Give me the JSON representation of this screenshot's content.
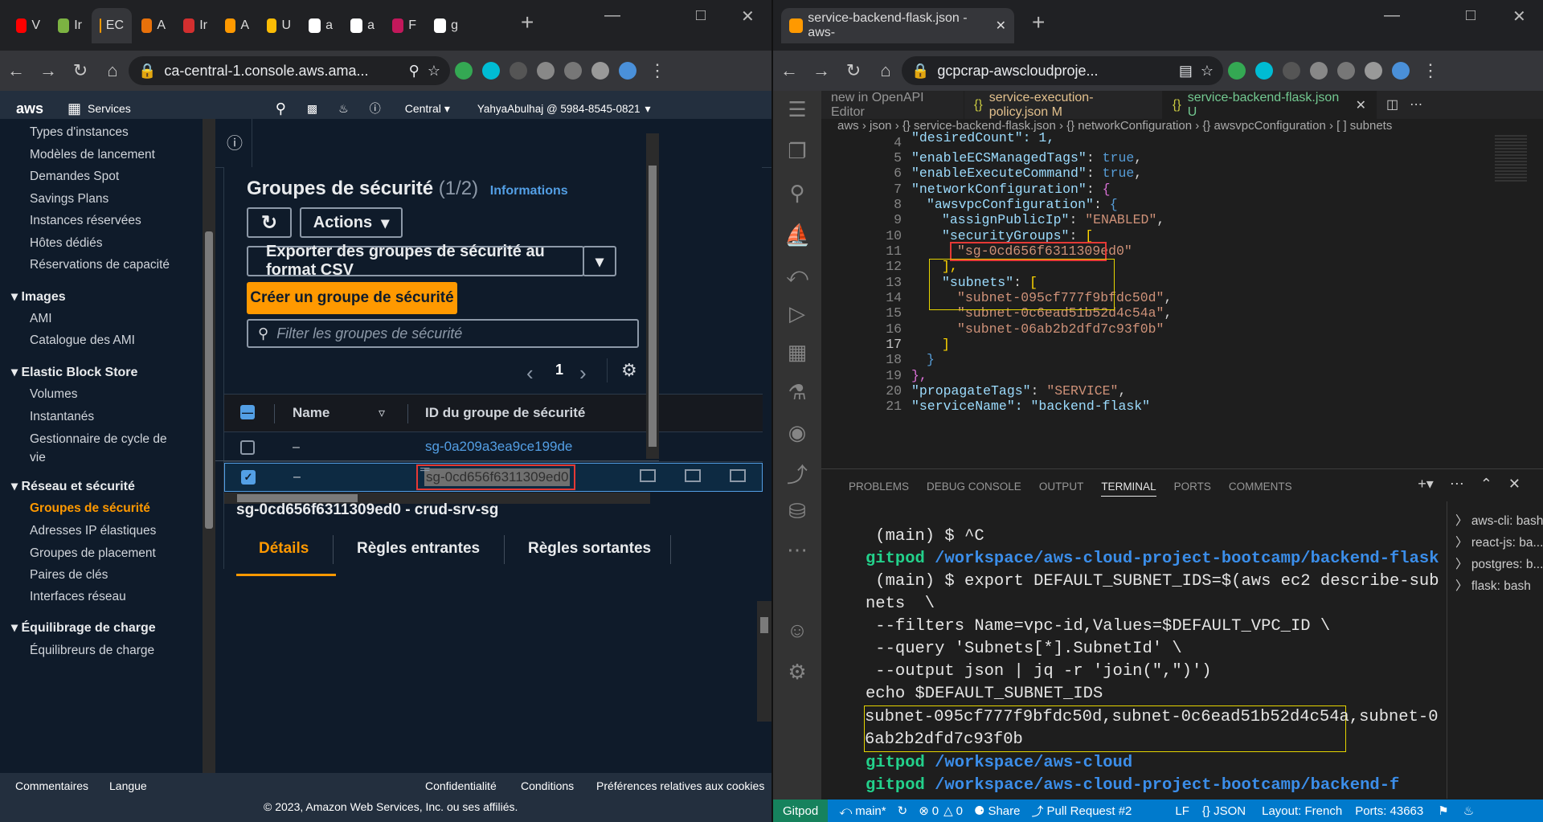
{
  "left_browser": {
    "tabs": [
      {
        "label": "V",
        "color": "#ff0000"
      },
      {
        "label": "Ir",
        "color": "#7cb342"
      },
      {
        "label": "EC",
        "color": "#ff9900"
      },
      {
        "label": "A",
        "color": "#e8710a"
      },
      {
        "label": "Ir",
        "color": "#d32f2f"
      },
      {
        "label": "A",
        "color": "#ff9900"
      },
      {
        "label": "U",
        "color": "#fbbc05"
      },
      {
        "label": "a",
        "color": "#ffffff"
      },
      {
        "label": "a",
        "color": "#ffffff"
      },
      {
        "label": "F",
        "color": "#c2185b"
      },
      {
        "label": "g",
        "color": "#ffffff"
      }
    ],
    "url": "ca-central-1.console.aws.ama..."
  },
  "aws": {
    "services": "Services",
    "region": "Central",
    "account": "YahyaAbulhaj @ 5984-8545-0821",
    "sidebar": [
      "Types d'instances",
      "Modèles de lancement",
      "Demandes Spot",
      "Savings Plans",
      "Instances réservées",
      "Hôtes dédiés",
      "Réservations de capacité"
    ],
    "sec_images": "Images",
    "images": [
      "AMI",
      "Catalogue des AMI"
    ],
    "sec_ebs": "Elastic Block Store",
    "ebs": [
      "Volumes",
      "Instantanés",
      "Gestionnaire de cycle de",
      "vie"
    ],
    "sec_net": "Réseau et sécurité",
    "net": [
      "Groupes de sécurité",
      "Adresses IP élastiques",
      "Groupes de placement",
      "Paires de clés",
      "Interfaces réseau"
    ],
    "sec_lb": "Équilibrage de charge",
    "lb": [
      "Équilibreurs de charge"
    ],
    "title": "Groupes de sécurité",
    "count": "(1/2)",
    "info": "Informations",
    "actions": "Actions",
    "export": "Exporter des groupes de sécurité au format CSV",
    "create": "Créer un groupe de sécurité",
    "filter_placeholder": "Filter les groupes de sécurité",
    "page": "1",
    "col_name": "Name",
    "col_id": "ID du groupe de sécurité",
    "rows": [
      {
        "name": "–",
        "id": "sg-0a209a3ea9ce199de"
      },
      {
        "name": "–",
        "id": "sg-0cd656f6311309ed0"
      }
    ],
    "detail_title": "sg-0cd656f6311309ed0 - crud-srv-sg",
    "dtabs": [
      "Détails",
      "Règles entrantes",
      "Règles sortantes"
    ],
    "footer": {
      "feedback": "Commentaires",
      "lang": "Langue",
      "privacy": "Confidentialité",
      "conditions": "Conditions",
      "cookies": "Préférences relatives aux cookies",
      "copyright": "© 2023, Amazon Web Services, Inc. ou ses affiliés."
    }
  },
  "right_browser": {
    "tab": "service-backend-flask.json - aws-",
    "url": "gcpcrap-awscloudproje..."
  },
  "vscode": {
    "tabs": [
      "new in OpenAPI Editor",
      "service-execution-policy.json M",
      "service-backend-flask.json U"
    ],
    "breadcrumb": "aws › json › {} service-backend-flask.json › {} networkConfiguration › {} awsvpcConfiguration › [ ] subnets",
    "lines": [
      "4",
      "5",
      "6",
      "7",
      "8",
      "9",
      "10",
      "11",
      "12",
      "13",
      "14",
      "15",
      "16",
      "17",
      "18",
      "19",
      "20",
      "21"
    ],
    "code": {
      "desired": "\"desiredCount\": 1,",
      "ecs_k": "\"enableECSManagedTags\"",
      "ecs_v": "true",
      "exec_k": "\"enableExecuteCommand\"",
      "exec_v": "true",
      "net_k": "\"networkConfiguration\"",
      "vpc_k": "\"awsvpcConfiguration\"",
      "pub_k": "\"assignPublicIp\"",
      "pub_v": "\"ENABLED\"",
      "sg_k": "\"securityGroups\"",
      "sg_v": "\"sg-0cd656f6311309ed0\"",
      "sub_k": "\"subnets\"",
      "sub1": "\"subnet-095cf777f9bfdc50d\"",
      "sub2": "\"subnet-0c6ead51b52d4c54a\"",
      "sub3": "\"subnet-06ab2b2dfd7c93f0b\"",
      "prop_k": "\"propagateTags\"",
      "prop_v": "\"SERVICE\"",
      "svc": "\"serviceName\": \"backend-flask\""
    },
    "panel_tabs": [
      "PROBLEMS",
      "DEBUG CONSOLE",
      "OUTPUT",
      "TERMINAL",
      "PORTS",
      "COMMENTS"
    ],
    "terminal": {
      "l1": " (main) $ ^C",
      "l2a": "gitpod",
      "l2b": " /workspace/aws-cloud-project-bootcamp/backend-flask",
      "l3": " (main) $ export DEFAULT_SUBNET_IDS=$(aws ec2 describe-sub",
      "l4": "nets  \\",
      "l5": " --filters Name=vpc-id,Values=$DEFAULT_VPC_ID \\",
      "l6": " --query 'Subnets[*].SubnetId' \\",
      "l7": " --output json | jq -r 'join(\",\")')",
      "l8": "echo $DEFAULT_SUBNET_IDS",
      "l9": "subnet-095cf777f9bfdc50d,subnet-0c6ead51b52d4c54a,subnet-0",
      "l10": "6ab2b2dfd7c93f0b",
      "l11a": "gitpod",
      "l11b": " /workspace/aws-cloud",
      "l12a": "gitpod",
      "l12b": " /workspace/aws-cloud-project-bootcamp/backend-f"
    },
    "term_list": [
      "aws-cli: bash",
      "react-js: ba...",
      "postgres: b...",
      "flask: bash"
    ],
    "status": {
      "gitpod": "Gitpod",
      "branch": "main*",
      "errors": "0",
      "warnings": "0",
      "share": "Share",
      "pr": "Pull Request #2",
      "lf": "LF",
      "lang": "{} JSON",
      "layout": "Layout: French",
      "ports": "Ports: 43663"
    }
  }
}
